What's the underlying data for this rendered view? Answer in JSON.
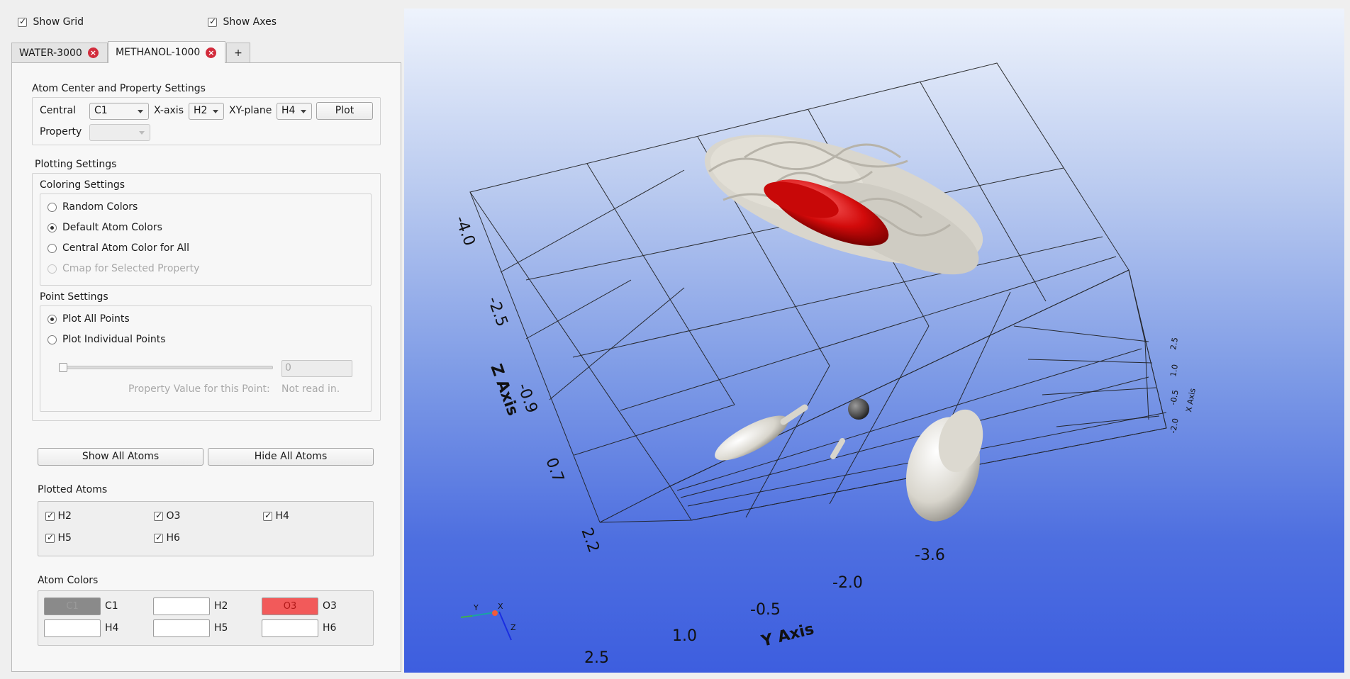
{
  "top_options": {
    "show_grid": {
      "label": "Show Grid",
      "checked": true
    },
    "show_axes": {
      "label": "Show Axes",
      "checked": true
    }
  },
  "tabs": [
    {
      "label": "WATER-3000",
      "active": false
    },
    {
      "label": "METHANOL-1000",
      "active": true
    }
  ],
  "add_tab_label": "+",
  "atom_center": {
    "title": "Atom Center and Property Settings",
    "central_label": "Central",
    "central_value": "C1",
    "xaxis_label": "X-axis",
    "xaxis_value": "H2",
    "xyplane_label": "XY-plane",
    "xyplane_value": "H4",
    "plot_button": "Plot",
    "property_label": "Property",
    "property_value": ""
  },
  "plotting": {
    "title": "Plotting Settings",
    "coloring": {
      "title": "Coloring Settings",
      "options": [
        {
          "label": "Random Colors",
          "selected": false,
          "enabled": true
        },
        {
          "label": "Default Atom Colors",
          "selected": true,
          "enabled": true
        },
        {
          "label": "Central Atom Color for All",
          "selected": false,
          "enabled": true
        },
        {
          "label": "Cmap for Selected Property",
          "selected": false,
          "enabled": false
        }
      ]
    },
    "points": {
      "title": "Point Settings",
      "options": [
        {
          "label": "Plot All Points",
          "selected": true
        },
        {
          "label": "Plot Individual Points",
          "selected": false
        }
      ],
      "slider_value": 0,
      "point_index_value": "0",
      "property_value_label": "Property Value for this Point:",
      "property_value_text": "Not read in."
    }
  },
  "buttons": {
    "show_all": "Show All Atoms",
    "hide_all": "Hide All Atoms"
  },
  "plotted_atoms": {
    "title": "Plotted Atoms",
    "items": [
      {
        "label": "H2",
        "checked": true
      },
      {
        "label": "O3",
        "checked": true
      },
      {
        "label": "H4",
        "checked": true
      },
      {
        "label": "H5",
        "checked": true
      },
      {
        "label": "H6",
        "checked": true
      }
    ]
  },
  "atom_colors": {
    "title": "Atom Colors",
    "items": [
      {
        "label": "C1",
        "swatch_text": "C1",
        "color": "#8a8a8a"
      },
      {
        "label": "H2",
        "swatch_text": "",
        "color": "#ffffff"
      },
      {
        "label": "O3",
        "swatch_text": "O3",
        "color": "#f25a5a"
      },
      {
        "label": "H4",
        "swatch_text": "",
        "color": "#ffffff"
      },
      {
        "label": "H5",
        "swatch_text": "",
        "color": "#ffffff"
      },
      {
        "label": "H6",
        "swatch_text": "",
        "color": "#ffffff"
      }
    ]
  },
  "viewport": {
    "z_axis_label": "Z Axis",
    "y_axis_label": "Y Axis",
    "x_axis_label": "X Axis",
    "z_ticks": [
      "-4.0",
      "-2.5",
      "-0.9",
      "0.7",
      "2.2"
    ],
    "y_ticks": [
      "2.5",
      "1.0",
      "-0.5",
      "-2.0",
      "-3.6"
    ],
    "x_ticks": [
      "2.5",
      "1.0",
      "-0.5",
      "-2.0"
    ],
    "orientation_labels": {
      "x": "X",
      "y": "Y",
      "z": "Z"
    },
    "colors": {
      "hydrogen": "#e8e6e0",
      "oxygen": "#d50a0a",
      "carbon": "#4a4a4a",
      "background_top": "#eef3fc",
      "background_bottom": "#3d5edf"
    }
  }
}
